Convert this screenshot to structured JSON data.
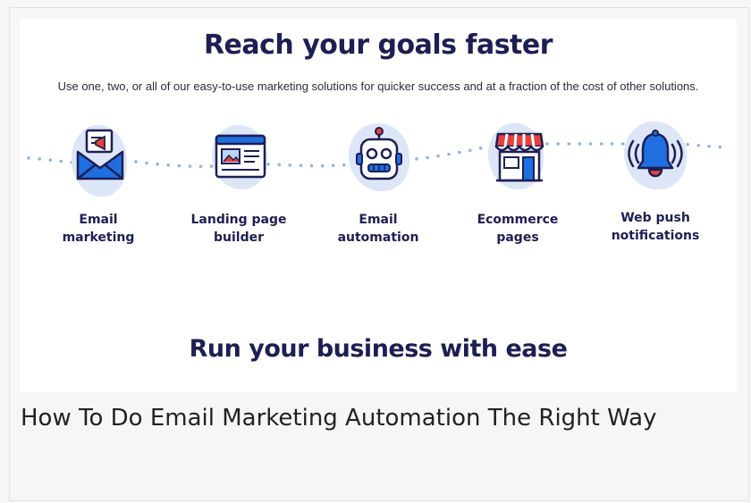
{
  "banner": {
    "heading": "Reach your goals faster",
    "subtitle": "Use one, two, or all of our easy-to-use marketing solutions for quicker success and at a fraction of the cost of other solutions.",
    "features": [
      {
        "line1": "Email",
        "line2": "marketing",
        "icon": "envelope-megaphone-icon"
      },
      {
        "line1": "Landing page",
        "line2": "builder",
        "icon": "landing-page-icon"
      },
      {
        "line1": "Email",
        "line2": "automation",
        "icon": "robot-icon"
      },
      {
        "line1": "Ecommerce",
        "line2": "pages",
        "icon": "storefront-icon"
      },
      {
        "line1": "Web push",
        "line2": "notifications",
        "icon": "bell-icon"
      }
    ],
    "bottom_heading": "Run your business with ease"
  },
  "caption": "How To Do Email Marketing Automation The Right Way",
  "colors": {
    "navy": "#1d1f54",
    "accent_blue": "#1f6fe0",
    "accent_red": "#e8413c",
    "blob": "#dde6f7",
    "dots": "#8fb4e6"
  }
}
